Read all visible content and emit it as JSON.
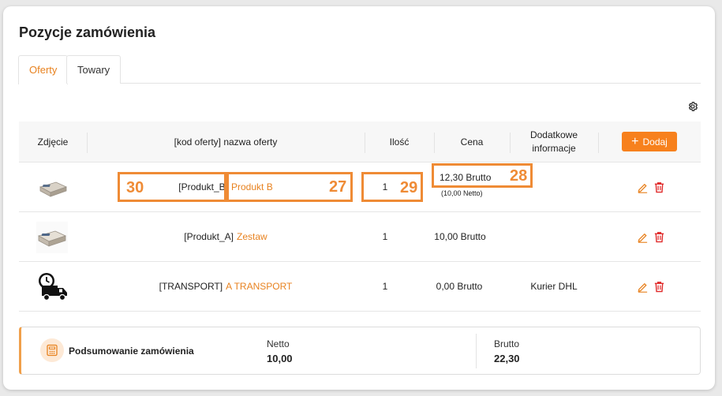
{
  "page": {
    "title": "Pozycje zamówienia",
    "tabs": [
      {
        "label": "Oferty",
        "active": true
      },
      {
        "label": "Towary",
        "active": false
      }
    ]
  },
  "table": {
    "headers": {
      "photo": "Zdjęcie",
      "name": "[kod oferty] nazwa oferty",
      "qty": "Ilość",
      "price": "Cena",
      "extra": "Dodatkowe informacje"
    },
    "add_button": {
      "label": "Dodaj",
      "icon": "plus-icon"
    },
    "rows": [
      {
        "code": "[Produkt_B]",
        "name": "Produkt B",
        "qty": "1",
        "price": "12,30 Brutto",
        "price_net": "(10,00 Netto)",
        "extra": "",
        "thumb_icon": "package-icon"
      },
      {
        "code": "[Produkt_A]",
        "name": "Zestaw",
        "qty": "1",
        "price": "10,00 Brutto",
        "price_net": "",
        "extra": "",
        "thumb_icon": "package-icon"
      },
      {
        "code": "[TRANSPORT]",
        "name": "A TRANSPORT",
        "qty": "1",
        "price": "0,00 Brutto",
        "price_net": "",
        "extra": "Kurier DHL",
        "thumb_icon": "delivery-truck-icon"
      }
    ]
  },
  "annotations": {
    "a30": "30",
    "a27": "27",
    "a29": "29",
    "a28": "28"
  },
  "summary": {
    "label": "Podsumowanie zamówienia",
    "netto_label": "Netto",
    "netto_value": "10,00",
    "brutto_label": "Brutto",
    "brutto_value": "22,30"
  },
  "colors": {
    "accent": "#f7811d",
    "annotation": "#ef8b35",
    "delete": "#e02a2a"
  }
}
